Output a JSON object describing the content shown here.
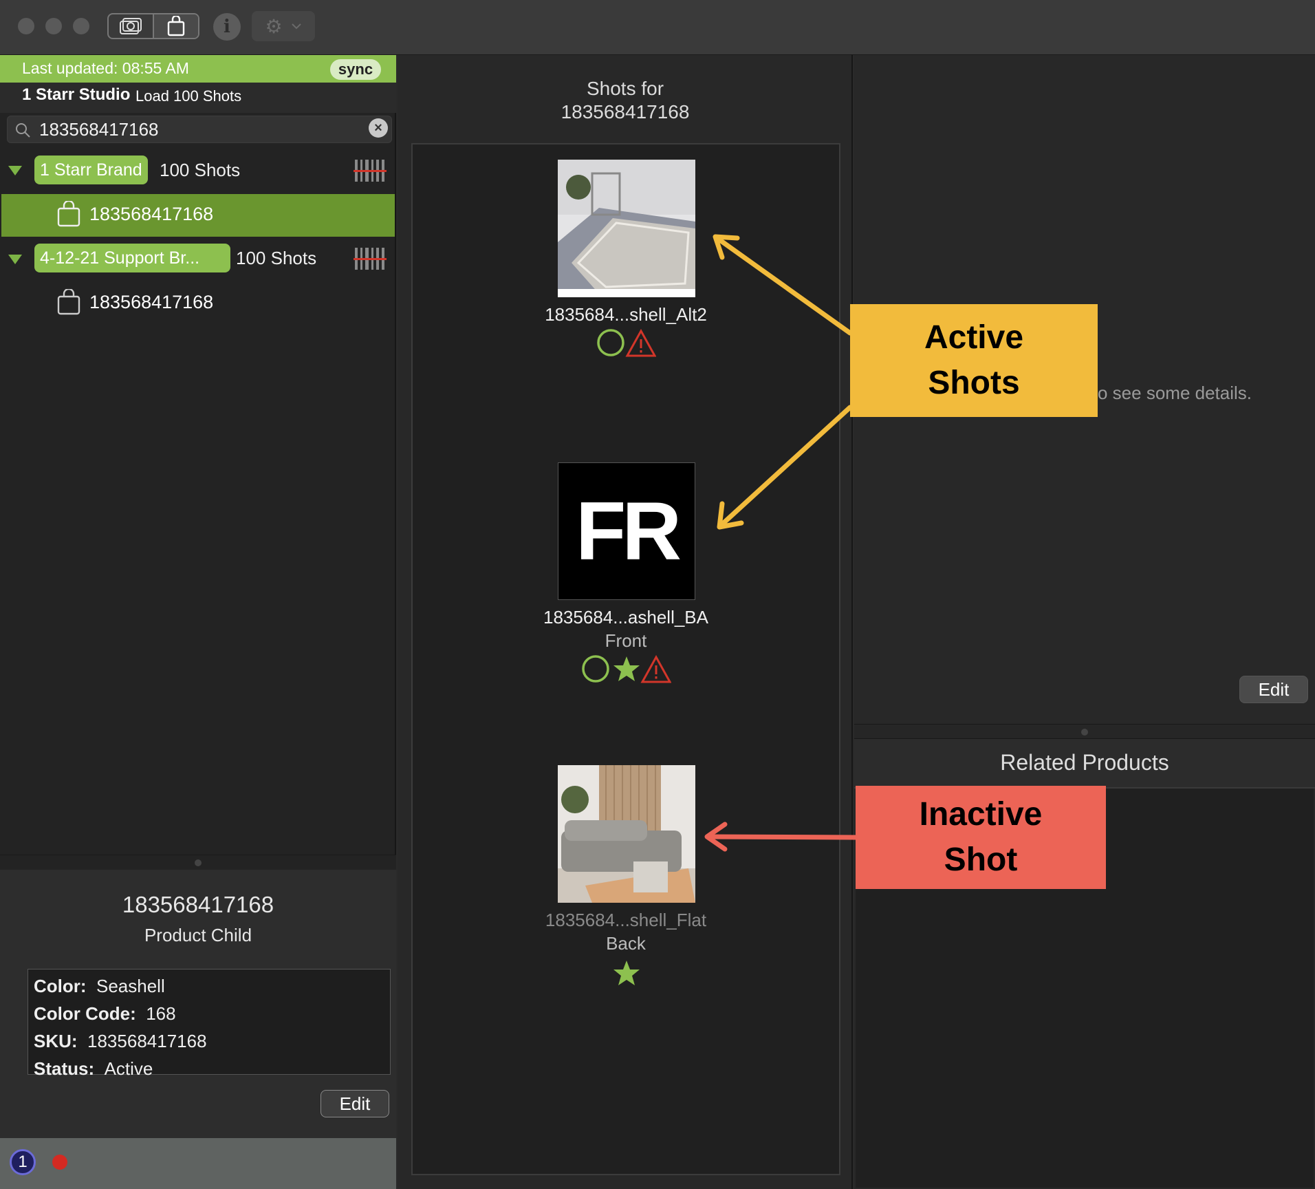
{
  "toolbar": {
    "info_glyph": "i"
  },
  "sidebar": {
    "last_updated": "Last updated: 08:55 AM",
    "sync_label": "sync",
    "studio_name": "1 Starr Studio",
    "load_label": "Load 100 Shots",
    "search_value": "183568417168",
    "groups": [
      {
        "name": "1 Starr Brand",
        "count": "100 Shots",
        "child": "183568417168",
        "selected": true
      },
      {
        "name": "4-12-21 Support Br...",
        "count": "100 Shots",
        "child": "183568417168",
        "selected": false
      }
    ],
    "detail": {
      "title": "183568417168",
      "subtitle": "Product Child",
      "attributes": [
        {
          "key": "Color:",
          "value": "Seashell"
        },
        {
          "key": "Color Code:",
          "value": "168"
        },
        {
          "key": "SKU:",
          "value": "183568417168"
        },
        {
          "key": "Status:",
          "value": "Active"
        }
      ],
      "edit_label": "Edit"
    }
  },
  "shots": {
    "header_line1": "Shots for",
    "header_line2": "183568417168",
    "items": [
      {
        "name": "1835684...shell_Alt2",
        "view": "",
        "active": true,
        "icons": [
          "circle-icon",
          "warning-icon"
        ]
      },
      {
        "name": "1835684...ashell_BA",
        "view": "Front",
        "thumb_text": "FR",
        "active": true,
        "icons": [
          "circle-icon",
          "star-icon",
          "warning-icon"
        ]
      },
      {
        "name": "1835684...shell_Flat",
        "view": "Back",
        "active": false,
        "icons": [
          "star-icon"
        ]
      }
    ]
  },
  "details_panel": {
    "hint": "o see some details.",
    "edit_label": "Edit"
  },
  "related": {
    "title": "Related Products"
  },
  "annotations": {
    "active_line1": "Active",
    "active_line2": "Shots",
    "inactive_line1": "Inactive",
    "inactive_line2": "Shot"
  },
  "colors": {
    "accent_green": "#8dc04f",
    "selected_row": "#6a962f",
    "warning_red": "#d2362a",
    "callout_yellow": "#f2bb3c",
    "callout_red": "#ec6456"
  }
}
